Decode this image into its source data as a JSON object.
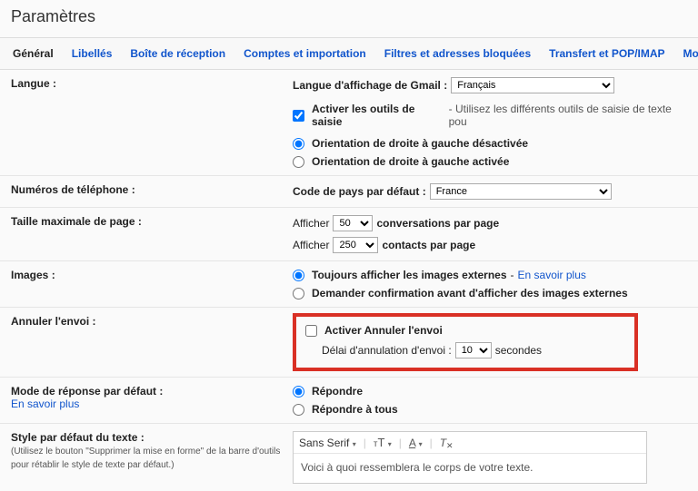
{
  "title": "Paramètres",
  "tabs": [
    "Général",
    "Libellés",
    "Boîte de réception",
    "Comptes et importation",
    "Filtres et adresses bloquées",
    "Transfert et POP/IMAP",
    "Modul"
  ],
  "lang": {
    "label": "Langue :",
    "display_label": "Langue d'affichage de Gmail :",
    "display_value": "Français",
    "tools_checked": true,
    "tools_label": "Activer les outils de saisie",
    "tools_hint": " - Utilisez les différents outils de saisie de texte pou",
    "rtl_off": "Orientation de droite à gauche désactivée",
    "rtl_on": "Orientation de droite à gauche activée"
  },
  "phone": {
    "label": "Numéros de téléphone :",
    "country_label": "Code de pays par défaut :",
    "country_value": "France"
  },
  "pagesize": {
    "label": "Taille maximale de page :",
    "show": "Afficher",
    "conv_value": "50",
    "conv_suffix": "conversations par page",
    "contacts_value": "250",
    "contacts_suffix": "contacts par page"
  },
  "images": {
    "label": "Images :",
    "always": "Toujours afficher les images externes",
    "learn": "En savoir plus",
    "ask": "Demander confirmation avant d'afficher des images externes"
  },
  "undo": {
    "label": "Annuler l'envoi :",
    "enable": "Activer Annuler l'envoi",
    "delay_label": "Délai d'annulation d'envoi :",
    "delay_value": "10",
    "delay_suffix": "secondes"
  },
  "reply": {
    "label": "Mode de réponse par défaut :",
    "learn": "En savoir plus",
    "reply": "Répondre",
    "replyall": "Répondre à tous"
  },
  "textstyle": {
    "label": "Style par défaut du texte :",
    "sublabel": "(Utilisez le bouton \"Supprimer la mise en forme\" de la barre d'outils pour rétablir le style de texte par défaut.)",
    "fontname": "Sans Serif",
    "sample": "Voici à quoi ressemblera le corps de votre texte."
  }
}
